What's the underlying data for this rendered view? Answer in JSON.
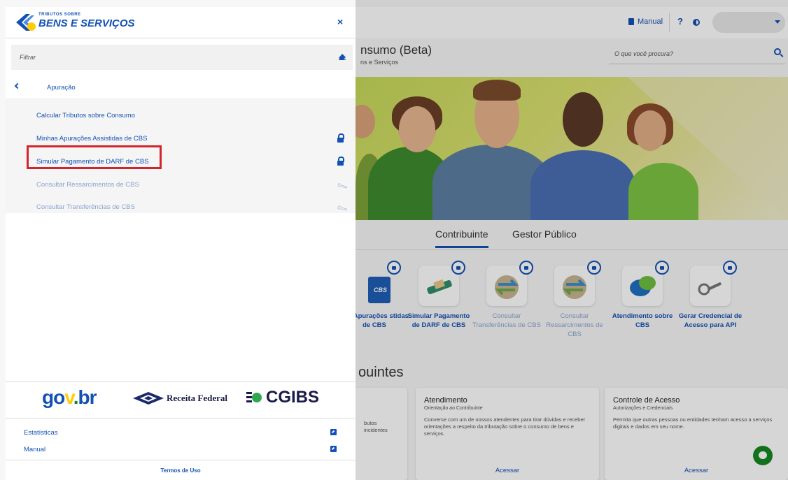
{
  "header": {
    "manual_label": "Manual",
    "help_label": "?",
    "page_title": "nsumo (Beta)",
    "page_subtitle": "ns e Serviços",
    "search_placeholder": "O que você procura?"
  },
  "tabs": [
    {
      "label": "Contribuinte",
      "active": true
    },
    {
      "label": "Gestor Público",
      "active": false
    }
  ],
  "services": [
    {
      "label": "nas Apurações stidas de CBS",
      "status": "locked",
      "icon": "cbs-book-icon"
    },
    {
      "label": "Simular Pagamento de DARF de CBS",
      "status": "locked",
      "icon": "darf-payment-icon"
    },
    {
      "label": "Consultar Transferências de CBS",
      "status": "maintenance",
      "icon": "transfer-icon"
    },
    {
      "label": "Consultar Ressarcimentos de CBS",
      "status": "maintenance",
      "icon": "refund-icon"
    },
    {
      "label": "Atendimento sobre CBS",
      "status": "locked",
      "icon": "chat-bubbles-icon"
    },
    {
      "label": "Gerar Credencial de Acesso para API",
      "status": "locked",
      "icon": "key-icon"
    }
  ],
  "section_title": "ouintes",
  "cards": [
    {
      "title": "",
      "subtitle": "",
      "body": "butos incidentes",
      "link": ""
    },
    {
      "title": "Atendimento",
      "subtitle": "Orientação ao Contribuinte",
      "body": "Converse com um de nossos atendentes para tirar dúvidas e receber orientações a respeito da tributação sobre o consumo de bens e serviços.",
      "link": "Acessar"
    },
    {
      "title": "Controle de Acesso",
      "subtitle": "Autorizações e Credenciais",
      "body": "Permita que outras pessoas ou entidades tenham acesso a serviços digitais e dados em seu nome.",
      "link": "Acessar"
    }
  ],
  "drawer": {
    "logo_small": "TRIBUTOS SOBRE",
    "logo_big": "BENS E SERVIÇOS",
    "close_label": "×",
    "filter_placeholder": "Filtrar",
    "back_label": "Apuração",
    "items": [
      {
        "label": "Calcular Tributos sobre Consumo",
        "icon": "none",
        "enabled": true
      },
      {
        "label": "Minhas Apurações Assistidas de CBS",
        "icon": "lock-icon",
        "enabled": true
      },
      {
        "label": "Simular Pagamento de DARF de CBS",
        "icon": "lock-icon",
        "enabled": true,
        "highlighted": true
      },
      {
        "label": "Consultar Ressarcimentos de CBS",
        "icon": "wrench-icon",
        "enabled": false
      },
      {
        "label": "Consultar Transferências de CBS",
        "icon": "wrench-icon",
        "enabled": false
      }
    ],
    "partners": {
      "govbr": "gov.br",
      "receita": "Receita Federal",
      "cgibs": "CGIBS"
    },
    "footer_links": [
      {
        "label": "Estatísticas"
      },
      {
        "label": "Manual"
      }
    ],
    "terms_label": "Termos de Uso"
  },
  "colors": {
    "primary": "#1351b4",
    "highlight_border": "#d4242b",
    "disabled_text": "#8aa4cf",
    "fab": "#168821"
  }
}
